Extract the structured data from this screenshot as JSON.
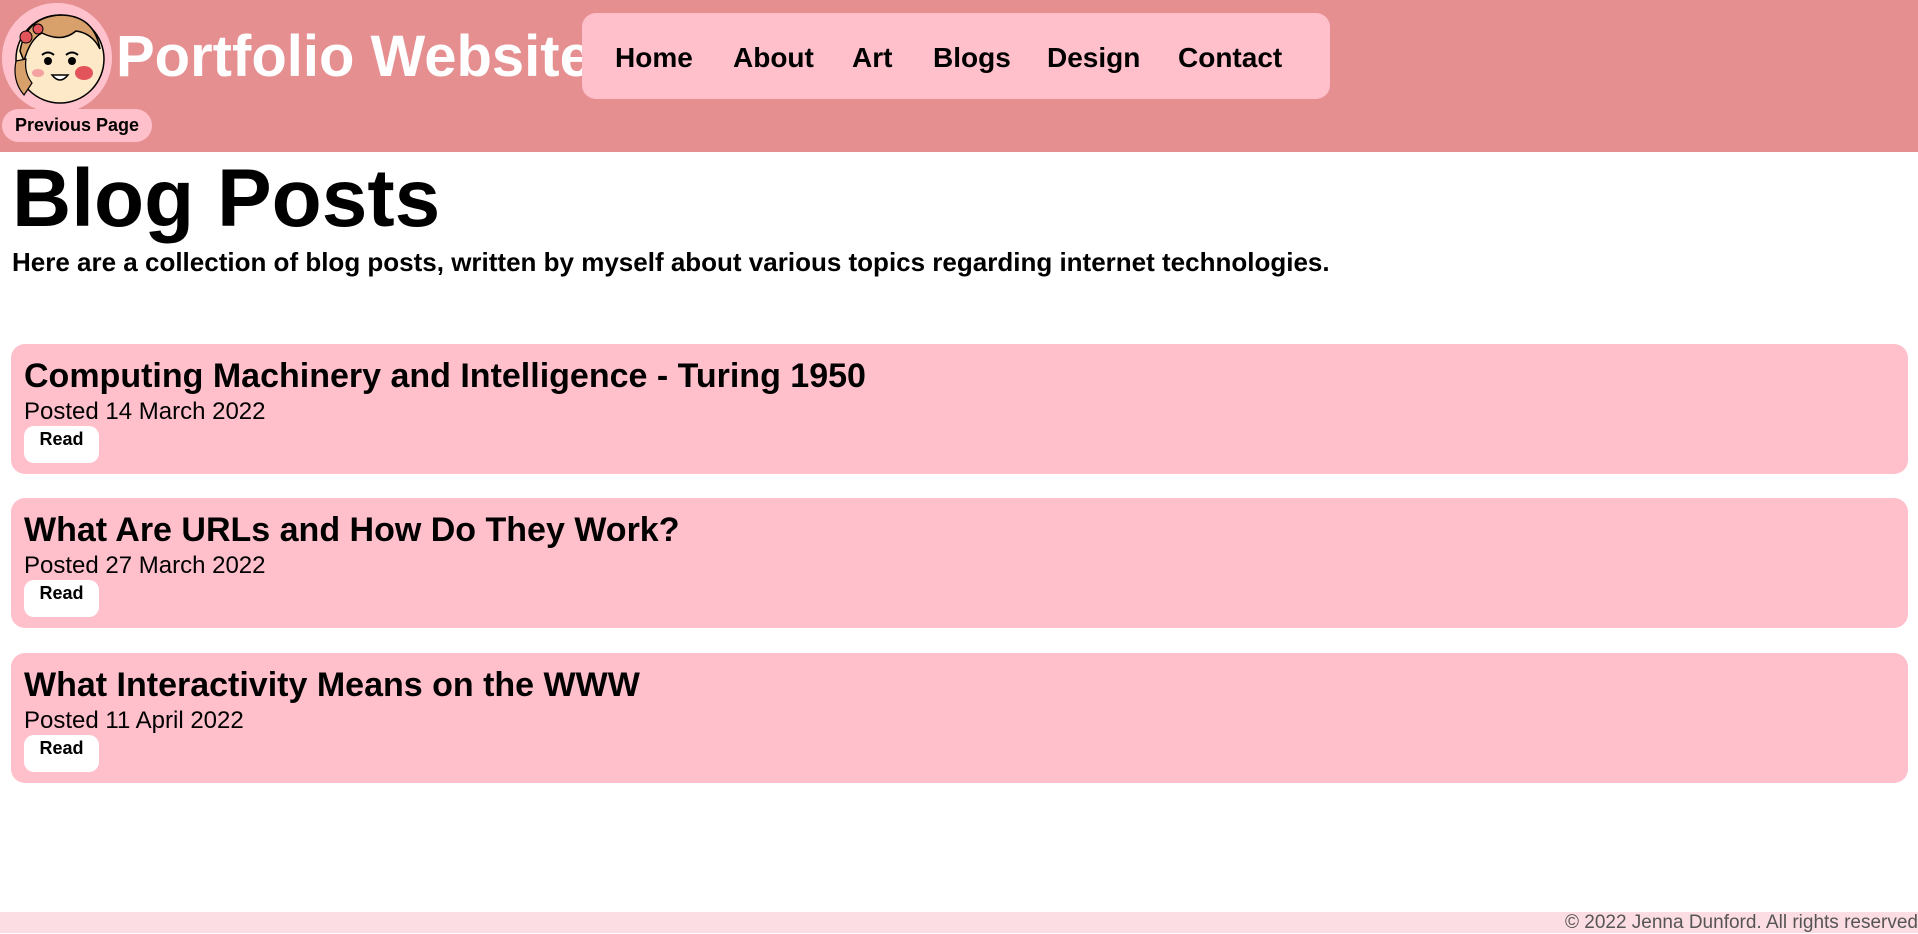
{
  "header": {
    "site_title": "Portfolio Website",
    "previous_page": "Previous Page"
  },
  "nav": {
    "items": [
      {
        "label": "Home"
      },
      {
        "label": "About"
      },
      {
        "label": "Art"
      },
      {
        "label": "Blogs"
      },
      {
        "label": "Design"
      },
      {
        "label": "Contact"
      }
    ]
  },
  "main": {
    "title": "Blog Posts",
    "intro": "Here are a collection of blog posts, written by myself about various topics regarding internet technologies.",
    "posts": [
      {
        "title": "Computing Machinery and Intelligence - Turing 1950",
        "date": "Posted 14 March 2022",
        "button": "Read"
      },
      {
        "title": "What Are URLs and How Do They Work?",
        "date": "Posted 27 March 2022",
        "button": "Read"
      },
      {
        "title": "What Interactivity Means on the WWW",
        "date": "Posted 11 April 2022",
        "button": "Read"
      }
    ]
  },
  "footer": {
    "copyright": "© 2022 Jenna Dunford. All rights reserved"
  },
  "colors": {
    "header_bg": "#e68f91",
    "accent_pink": "#ffbfcb",
    "footer_bg": "#fcdde3"
  }
}
